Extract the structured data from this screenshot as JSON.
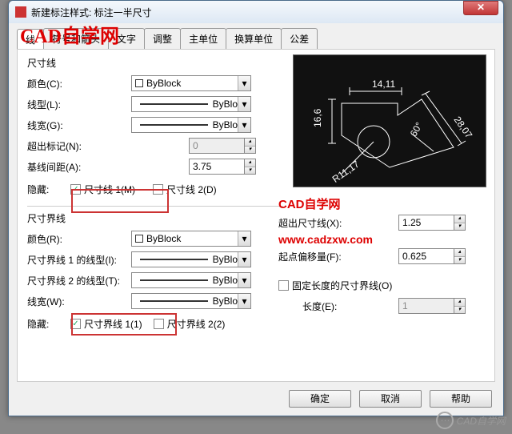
{
  "window": {
    "title": "新建标注样式: 标注一半尺寸"
  },
  "watermark": {
    "top": "CAD自学网",
    "mid1": "CAD自学网",
    "mid2": "www.cadzxw.com",
    "footer": "CAD自学网"
  },
  "tabs": {
    "t1": "线",
    "t2": "符号和箭头",
    "t3": "文字",
    "t4": "调整",
    "t5": "主单位",
    "t6": "换算单位",
    "t7": "公差"
  },
  "groups": {
    "dimline": "尺寸线",
    "extline": "尺寸界线"
  },
  "labels": {
    "color_c": "颜色(C):",
    "linetype_l": "线型(L):",
    "linewt_g": "线宽(G):",
    "ext_n": "超出标记(N):",
    "base_a": "基线间距(A):",
    "hide": "隐藏:",
    "dim1_m": "尺寸线 1(M)",
    "dim2_d": "尺寸线 2(D)",
    "color_r": "颜色(R):",
    "ext1_lt": "尺寸界线 1 的线型(I):",
    "ext2_lt": "尺寸界线 2 的线型(T):",
    "linewt_w": "线宽(W):",
    "ext1": "尺寸界线 1(1)",
    "ext2": "尺寸界线 2(2)",
    "beyond_x": "超出尺寸线(X):",
    "offset_f": "起点偏移量(F):",
    "fixed_o": "固定长度的尺寸界线(O)",
    "len_e": "长度(E):"
  },
  "values": {
    "byblock": "ByBlock",
    "ext_n": "0",
    "base_a": "3.75",
    "beyond_x": "1.25",
    "offset_f": "0.625",
    "len_e": "1"
  },
  "preview": {
    "d1": "14,11",
    "d2": "16,6",
    "d3": "28,07",
    "d4": "60°",
    "d5": "R11,17"
  },
  "buttons": {
    "ok": "确定",
    "cancel": "取消",
    "help": "帮助"
  }
}
